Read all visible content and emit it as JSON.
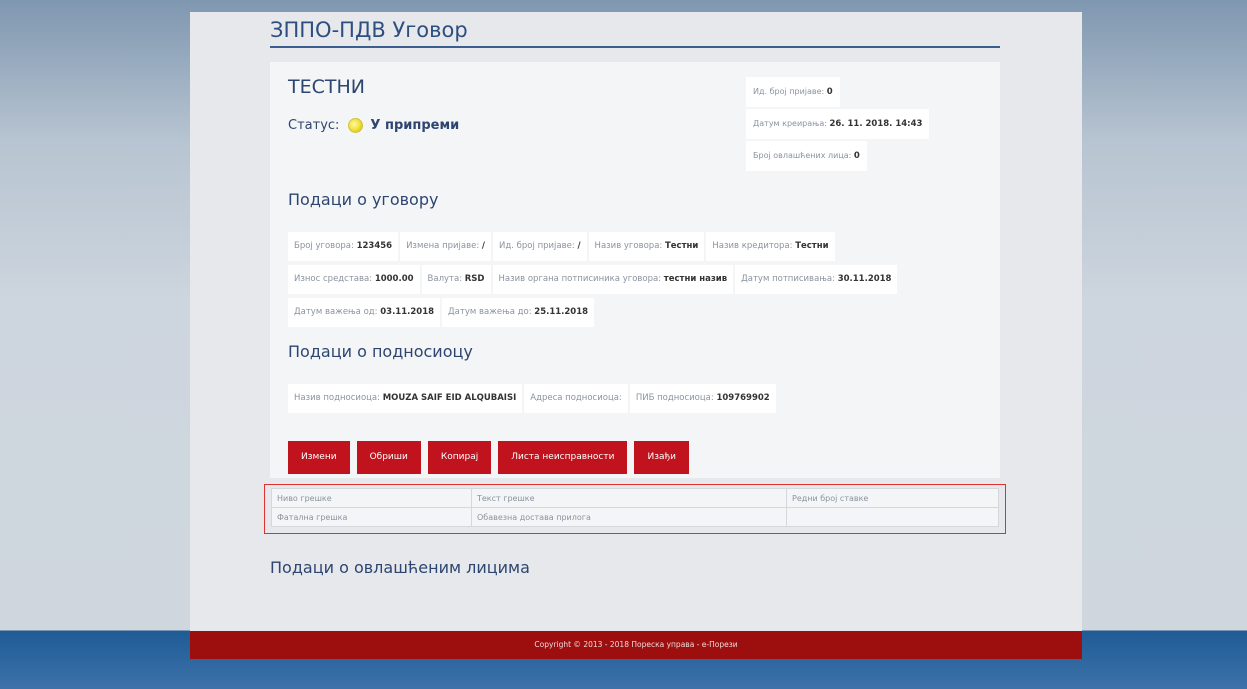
{
  "header": {
    "title": "ЗППО-ПДВ Уговор"
  },
  "card": {
    "name": "ТЕСТНИ",
    "status_label": "Статус:",
    "status_value": "У припреми",
    "meta": [
      {
        "label": "Ид. број пријаве:",
        "value": "0"
      },
      {
        "label": "Датум креирања:",
        "value": "26. 11. 2018. 14:43"
      },
      {
        "label": "Број овлашћених лица:",
        "value": "0"
      }
    ]
  },
  "contract": {
    "heading": "Подаци о уговору",
    "row1": [
      {
        "label": "Број уговора:",
        "value": "123456"
      },
      {
        "label": "Измена пријаве:",
        "value": "/"
      },
      {
        "label": "Ид. број пријаве:",
        "value": "/"
      },
      {
        "label": "Назив уговора:",
        "value": "Тестни"
      },
      {
        "label": "Назив кредитора:",
        "value": "Тестни"
      }
    ],
    "row2": [
      {
        "label": "Износ средстава:",
        "value": "1000.00"
      },
      {
        "label": "Валута:",
        "value": "RSD"
      },
      {
        "label": "Назив органа потписиника уговора:",
        "value": "тестни назив"
      },
      {
        "label": "Датум потписивања:",
        "value": "30.11.2018"
      }
    ],
    "row3": [
      {
        "label": "Датум важења од:",
        "value": "03.11.2018"
      },
      {
        "label": "Датум важења до:",
        "value": "25.11.2018"
      }
    ]
  },
  "applicant": {
    "heading": "Подаци о подносиоцу",
    "row": [
      {
        "label": "Назив подносиоца:",
        "value": "MOUZA SAIF EID ALQUBAISI"
      },
      {
        "label": "Адреса подносиоца:",
        "value": ""
      },
      {
        "label": "ПИБ подносиоца:",
        "value": "109769902"
      }
    ]
  },
  "buttons": {
    "edit": "Измени",
    "delete": "Обриши",
    "copy": "Копирај",
    "errors": "Листа неисправности",
    "exit": "Изађи"
  },
  "error_table": {
    "headers": [
      "Ниво грешке",
      "Текст грешке",
      "Редни број ставке"
    ],
    "rows": [
      [
        "Фатална грешка",
        "Обавезна достава прилога",
        ""
      ]
    ]
  },
  "authorized": {
    "heading": "Подаци о овлашћеним лицима"
  },
  "footer": {
    "text": "Copyright © 2013 - 2018 Пореска управа - е-Порези"
  },
  "colors": {
    "accent": "#c0131d",
    "footer": "#9d0f0f",
    "heading": "#2d4570"
  }
}
